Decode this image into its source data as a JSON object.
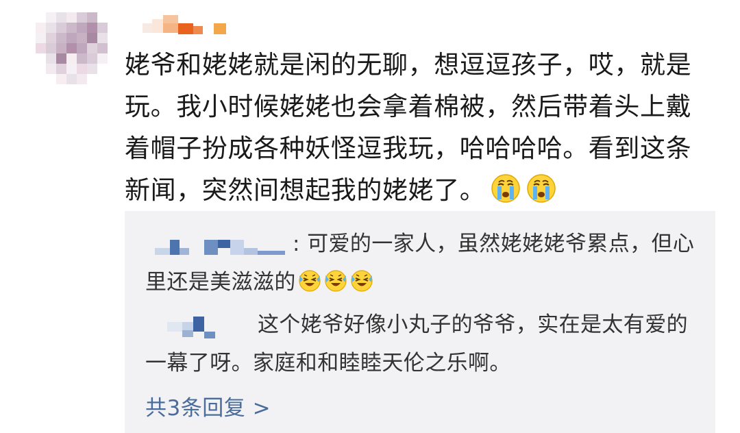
{
  "comment": {
    "text": "姥爷和姥姥就是闲的无聊，想逗逗孩子，哎，就是玩。我小时候姥姥也会拿着棉被，然后带着头上戴着帽子扮成各种妖怪逗我玩，哈哈哈哈。看到这条新闻，突然间想起我的姥姥了。",
    "emojis": [
      "crying-emoji",
      "crying-emoji"
    ]
  },
  "replies": [
    {
      "separator": ":",
      "text": " 可爱的一家人，虽然姥姥姥爷累点，但心里还是美滋滋的",
      "emojis": [
        "laughing-tears-emoji",
        "laughing-tears-emoji",
        "laughing-tears-emoji"
      ]
    },
    {
      "text": "这个姥爷好像小丸子的爷爷，实在是太有爱的一幕了呀。家庭和和睦睦天伦之乐啊。"
    }
  ],
  "more_replies_label": "共3条回复 >",
  "colors": {
    "link": "#4a6c9b",
    "reply_background": "#f2f2f4",
    "username_accent": "#e8641e"
  }
}
